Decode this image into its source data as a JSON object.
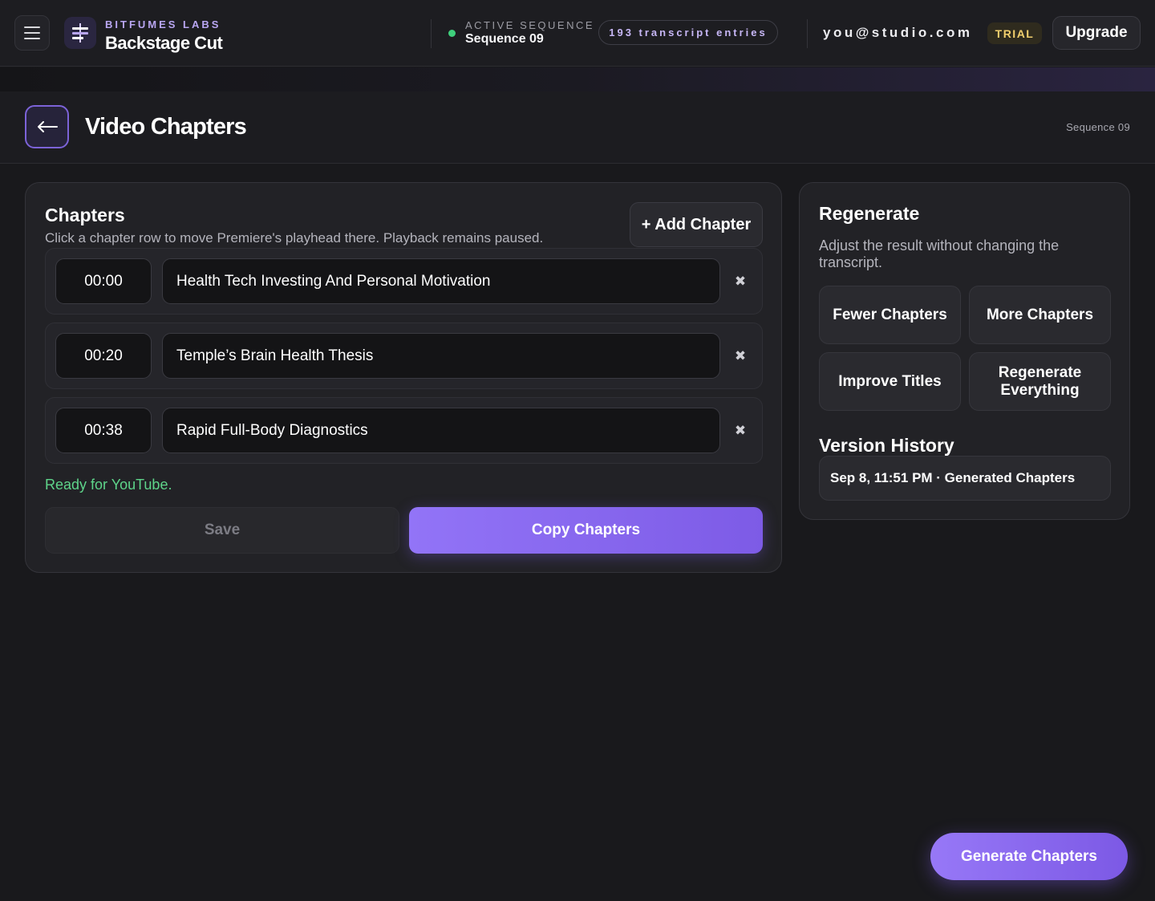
{
  "app": {
    "brand_label": "BITFUMES LABS",
    "brand_name": "Backstage Cut"
  },
  "header": {
    "active_label": "ACTIVE SEQUENCE",
    "active_value": "Sequence 09",
    "transcript_badge": "193 transcript entries",
    "user_email": "you@studio.com",
    "plan_badge": "TRIAL",
    "upgrade_label": "Upgrade"
  },
  "page": {
    "title": "Video Chapters",
    "sequence": "Sequence 09"
  },
  "chapters": {
    "title": "Chapters",
    "hint": "Click a chapter row to move Premiere's playhead there. Playback remains paused.",
    "add_label": "+ Add Chapter",
    "items": [
      {
        "time": "00:00",
        "title": "Health Tech Investing And Personal Motivation"
      },
      {
        "time": "00:20",
        "title": "Temple’s Brain Health Thesis"
      },
      {
        "time": "00:38",
        "title": "Rapid Full-Body Diagnostics"
      }
    ],
    "status": "Ready for YouTube.",
    "save_label": "Save",
    "copy_label": "Copy Chapters"
  },
  "regenerate": {
    "title": "Regenerate",
    "hint": "Adjust the result without changing the transcript.",
    "options": [
      "Fewer Chapters",
      "More Chapters",
      "Improve Titles",
      "Regenerate Everything"
    ]
  },
  "version_history": {
    "title": "Version History",
    "items": [
      "Sep 8, 11:51 PM · Generated Chapters"
    ]
  },
  "generate_label": "Generate Chapters",
  "colors": {
    "accent": "#8b6cf2",
    "success": "#5ed48a",
    "trial": "#f1cf6d",
    "background": "#19191c"
  }
}
